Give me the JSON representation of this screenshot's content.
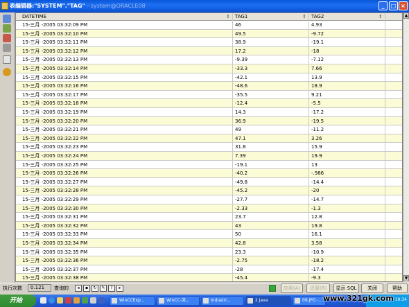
{
  "window": {
    "title": "表编辑器:\"SYSTEM\".\"TAG\"",
    "title_dim": " - system@ORACLE08",
    "buttons": [
      "_",
      "□",
      "×"
    ]
  },
  "grid": {
    "columns": [
      "DATETIME",
      "TAG1",
      "TAG2"
    ],
    "rows": [
      [
        "15-三月 -2005 03:32:09 PM",
        "46",
        "4.93"
      ],
      [
        "15-三月 -2005 03:32:10 PM",
        "49.5",
        "-9.72"
      ],
      [
        "15-三月 -2005 03:32:11 PM",
        "38.9",
        "-19.1"
      ],
      [
        "15-三月 -2005 03:32:12 PM",
        "17.2",
        "-18"
      ],
      [
        "15-三月 -2005 03:32:13 PM",
        "-9.39",
        "-7.12"
      ],
      [
        "15-三月 -2005 03:32:14 PM",
        "-33.3",
        "7.66"
      ],
      [
        "15-三月 -2005 03:32:15 PM",
        "-42.1",
        "13.9"
      ],
      [
        "15-三月 -2005 03:32:16 PM",
        "-48.6",
        "18.9"
      ],
      [
        "15-三月 -2005 03:32:17 PM",
        "-35.5",
        "9.21"
      ],
      [
        "15-三月 -2005 03:32:18 PM",
        "-12.4",
        "-5.5"
      ],
      [
        "15-三月 -2005 03:32:19 PM",
        "14.3",
        "-17.2"
      ],
      [
        "15-三月 -2005 03:32:20 PM",
        "36.9",
        "-19.5"
      ],
      [
        "15-三月 -2005 03:32:21 PM",
        "49",
        "-11.2"
      ],
      [
        "15-三月 -2005 03:32:22 PM",
        "47.1",
        "3.26"
      ],
      [
        "15-三月 -2005 03:32:23 PM",
        "31.8",
        "15.9"
      ],
      [
        "15-三月 -2005 03:32:24 PM",
        "7.39",
        "19.9"
      ],
      [
        "15-三月 -2005 03:32:25 PM",
        "-19.1",
        "13"
      ],
      [
        "15-三月 -2005 03:32:26 PM",
        "-40.2",
        "-.986"
      ],
      [
        "15-三月 -2005 03:32:27 PM",
        "-49.8",
        "-14.4"
      ],
      [
        "15-三月 -2005 03:32:28 PM",
        "-45.2",
        "-20"
      ],
      [
        "15-三月 -2005 03:32:29 PM",
        "-27.7",
        "-14.7"
      ],
      [
        "15-三月 -2005 03:32:30 PM",
        "-2.33",
        "-1.3"
      ],
      [
        "15-三月 -2005 03:32:31 PM",
        "23.7",
        "12.8"
      ],
      [
        "15-三月 -2005 03:32:32 PM",
        "43",
        "19.8"
      ],
      [
        "15-三月 -2005 03:32:33 PM",
        "50",
        "16.1"
      ],
      [
        "15-三月 -2005 03:32:34 PM",
        "42.8",
        "3.58"
      ],
      [
        "15-三月 -2005 03:32:35 PM",
        "23.3",
        "-10.9"
      ],
      [
        "15-三月 -2005 03:32:36 PM",
        "-2.75",
        "-18.2"
      ],
      [
        "15-三月 -2005 03:32:37 PM",
        "-28",
        "-17.4"
      ],
      [
        "15-三月 -2005 03:32:38 PM",
        "-45.4",
        "-9.3"
      ]
    ]
  },
  "status": {
    "exec_label": "执行次数",
    "exec_value": "0.121",
    "nav_label": "查询的",
    "buttons": {
      "apply": "应用(A)",
      "revert": "还原(R)",
      "show_sql": "显示 SQL",
      "close": "关闭",
      "help": "帮助"
    }
  },
  "taskbar": {
    "start": "开始",
    "tasks": [
      "WinCCExp...",
      "WinCC-流...",
      "Industri...",
      "2 Java",
      "09.JPG -..."
    ],
    "tray_text": "19:34"
  },
  "watermark": "www.321gk.com"
}
